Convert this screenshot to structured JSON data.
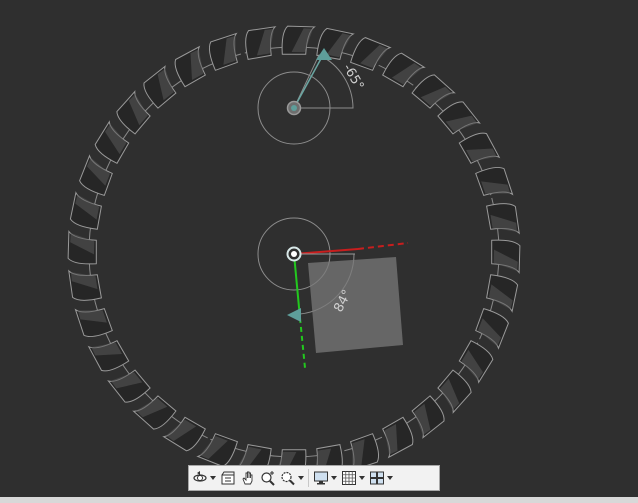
{
  "gizmo_top": {
    "angle_label": "-65°"
  },
  "gizmo_center": {
    "angle_label": "84°"
  },
  "gear": {
    "teeth": 36
  },
  "colors": {
    "background": "#2f2f2f",
    "x_axis": "#c81e1e",
    "y_axis": "#22c81e",
    "gizmo": "#8c8c8c",
    "handle": "#5e9e9a"
  },
  "toolbar": {
    "icons": [
      "orbit-icon",
      "showmotion-icon",
      "pan-icon",
      "zoom-realtime-icon",
      "zoom-window-icon",
      "display-icon",
      "grid-icon",
      "viewports-icon"
    ]
  }
}
